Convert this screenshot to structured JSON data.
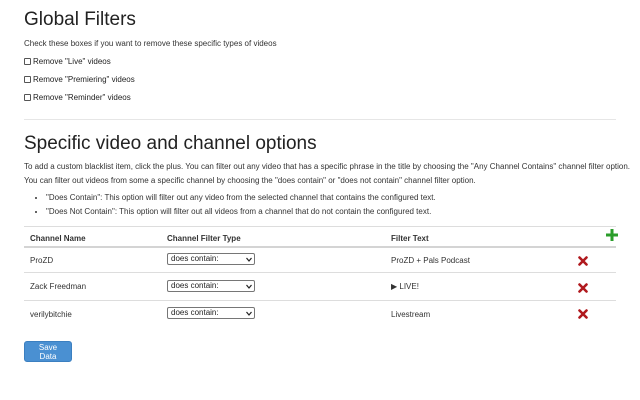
{
  "global_filters": {
    "title": "Global Filters",
    "description": "Check these boxes if you want to remove these specific types of videos",
    "options": [
      {
        "label": "Remove \"Live\" videos",
        "checked": false
      },
      {
        "label": "Remove \"Premiering\" videos",
        "checked": false
      },
      {
        "label": "Remove \"Reminder\" videos",
        "checked": false
      }
    ]
  },
  "specific": {
    "title": "Specific video and channel options",
    "desc_line1": "To add a custom blacklist item, click the plus. You can filter out any video that has a specific phrase in the title by choosing the \"Any Channel Contains\" channel filter option.",
    "desc_line2": "You can filter out videos from some a specific channel by choosing the \"does contain\" or \"does not contain\" channel filter option.",
    "bullets": [
      "\"Does Contain\": This option will filter out any video from the selected channel that contains the configured text.",
      "\"Does Not Contain\": This option will filter out all videos from a channel that do not contain the configured text."
    ]
  },
  "table": {
    "headers": {
      "channel_name": "Channel Name",
      "filter_type": "Channel Filter Type",
      "filter_text": "Filter Text"
    },
    "rows": [
      {
        "channel": "ProZD",
        "filter_type": "does contain:",
        "filter_text": "ProZD + Pals Podcast"
      },
      {
        "channel": "Zack Freedman",
        "filter_type": "does contain:",
        "filter_text": "▶ LIVE!"
      },
      {
        "channel": "verilybitchie",
        "filter_type": "does contain:",
        "filter_text": "Livestream"
      }
    ]
  },
  "save_label": "Save Data",
  "icons": {
    "add": "plus-icon",
    "delete": "x-icon",
    "dropdown": "chevron-down-icon"
  },
  "colors": {
    "add": "#2a9d2a",
    "delete": "#b0191e",
    "button": "#4a90d2"
  }
}
